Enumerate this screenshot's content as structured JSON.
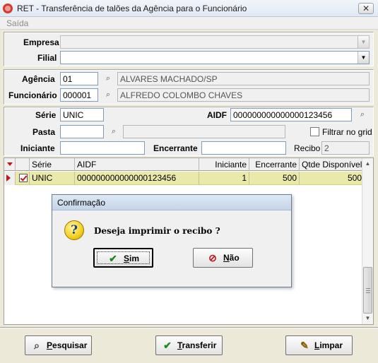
{
  "window": {
    "title": "RET - Transferência de talões da Agência para o Funcionário",
    "close_label": "✕"
  },
  "menu": {
    "items": [
      {
        "label": "Saída"
      }
    ]
  },
  "filters": {
    "empresa": {
      "label": "Empresa",
      "value": ""
    },
    "filial": {
      "label": "Filial",
      "value": ""
    }
  },
  "agencia": {
    "label": "Agência",
    "code": "01",
    "name": "ALVARES MACHADO/SP"
  },
  "funcionario": {
    "label": "Funcionário",
    "code": "000001",
    "name": "ALFREDO COLOMBO CHAVES"
  },
  "serie": {
    "label": "Série",
    "value": "UNIC"
  },
  "aidf": {
    "label": "AIDF",
    "value": "000000000000000123456"
  },
  "pasta": {
    "label": "Pasta",
    "value": "",
    "description": ""
  },
  "filtrar_no_grid": {
    "label": "Filtrar no grid",
    "checked": false
  },
  "iniciante": {
    "label": "Iniciante",
    "value": ""
  },
  "encerrante": {
    "label": "Encerrante",
    "value": ""
  },
  "recibo": {
    "label": "Recibo",
    "value": "2"
  },
  "grid": {
    "columns": [
      "Série",
      "AIDF",
      "Iniciante",
      "Encerrante",
      "Qtde Disponível"
    ],
    "rows": [
      {
        "checked": true,
        "serie": "UNIC",
        "aidf": "000000000000000123456",
        "iniciante": "1",
        "encerrante": "500",
        "qtde": "500"
      }
    ]
  },
  "dialog": {
    "title": "Confirmação",
    "message": "Deseja imprimir o recibo ?",
    "yes_label": "Sim",
    "no_label": "Não"
  },
  "footer": {
    "pesquisar_label": "Pesquisar",
    "transferir_label": "Transferir",
    "limpar_label": "Limpar"
  },
  "colors": {
    "row_highlight": "#e9e9a9",
    "accent_red": "#c0161c",
    "ok_green": "#1a8a1a"
  }
}
